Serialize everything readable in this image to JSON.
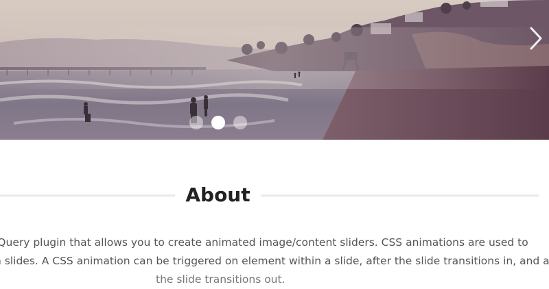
{
  "slider": {
    "next_arrow_icon": "chevron-right-icon",
    "dots": [
      {
        "label": "slide-1",
        "active": false
      },
      {
        "label": "slide-2",
        "active": true
      },
      {
        "label": "slide-3",
        "active": false
      }
    ]
  },
  "about": {
    "title": "About",
    "lines": [
      "jQuery plugin that allows you to create animated image/content sliders. CSS animations are used to",
      "n slides. A CSS animation can be triggered on element within a slide, after the slide transitions in, and as",
      "the slide transitions out."
    ]
  },
  "colors": {
    "text_dark": "#222222",
    "text_body": "#555555",
    "rule": "#e9e9e9"
  }
}
